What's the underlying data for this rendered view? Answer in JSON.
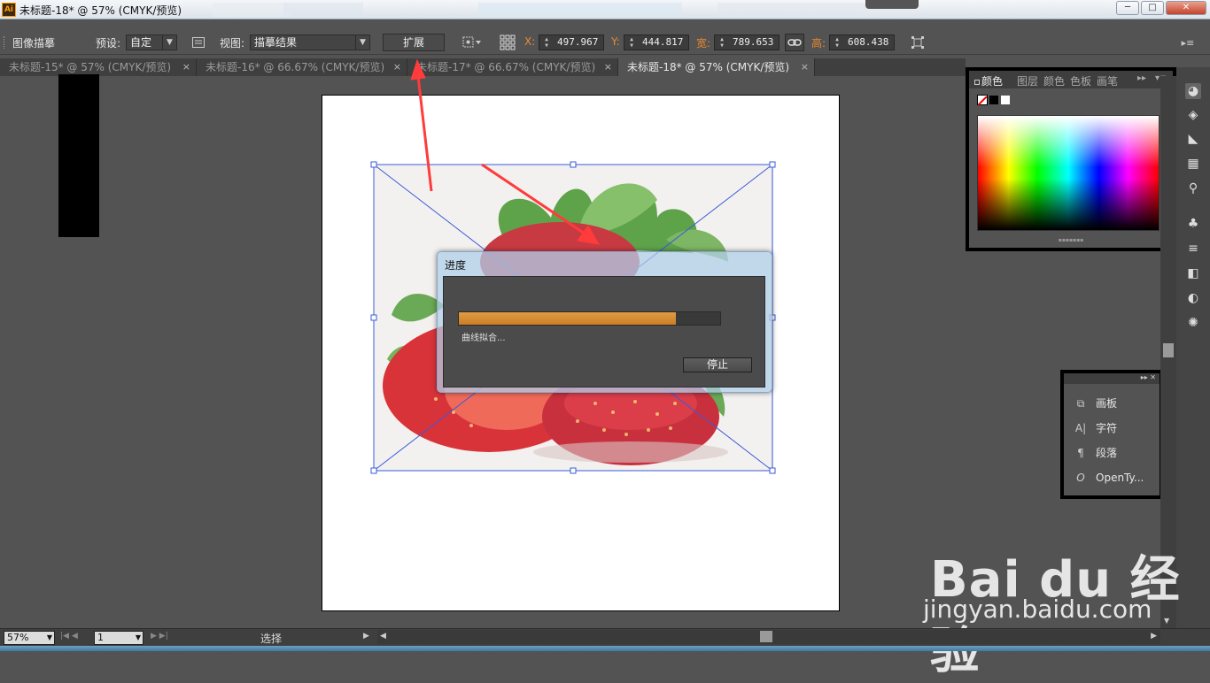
{
  "window": {
    "app_icon": "Ai",
    "title": "未标题-18* @ 57% (CMYK/预览)",
    "min_label": "─",
    "max_label": "□",
    "close_label": "✕"
  },
  "control_bar": {
    "panel_name": "图像描摹",
    "preset_label": "预设:",
    "preset_value": "自定",
    "view_label": "视图:",
    "view_value": "描摹结果",
    "expand_label": "扩展",
    "x_label": "X:",
    "x_value": "497.967",
    "y_label": "Y:",
    "y_value": "444.817",
    "w_label": "宽:",
    "w_value": "789.653",
    "h_label": "高:",
    "h_value": "608.438"
  },
  "doc_tabs": [
    {
      "label": "未标题-15* @ 57% (CMYK/预览)",
      "active": false
    },
    {
      "label": "未标题-16* @ 66.67% (CMYK/预览)",
      "active": false
    },
    {
      "label": "未标题-17* @ 66.67% (CMYK/预览)",
      "active": false
    },
    {
      "label": "未标题-18* @ 57% (CMYK/预览)",
      "active": true
    }
  ],
  "tab_close": "×",
  "progress_dialog": {
    "title": "进度",
    "status": "曲线拟合...",
    "progress": 0.83,
    "stop_label": "停止"
  },
  "color_panel": {
    "tabs": [
      "颜色",
      "图层",
      "颜色",
      "色板",
      "画笔"
    ],
    "active_tab": 0
  },
  "type_panel": {
    "items": [
      {
        "icon": "artboard-icon",
        "glyph": "⧉",
        "label": "画板"
      },
      {
        "icon": "character-icon",
        "glyph": "A|",
        "label": "字符"
      },
      {
        "icon": "paragraph-icon",
        "glyph": "¶",
        "label": "段落"
      },
      {
        "icon": "opentype-icon",
        "glyph": "O",
        "label": "OpenTy..."
      }
    ]
  },
  "status_bar": {
    "zoom": "57%",
    "artboard_number": "1",
    "tool_status": "选择"
  },
  "watermark": {
    "logo": "Bai du 经验",
    "url": "jingyan.baidu.com"
  },
  "colors": {
    "accent_orange": "#e88a2e",
    "progress_fill": "#d68a33",
    "annotation_arrow": "#ff3b3b",
    "selection_blue": "#3a5bd9"
  }
}
